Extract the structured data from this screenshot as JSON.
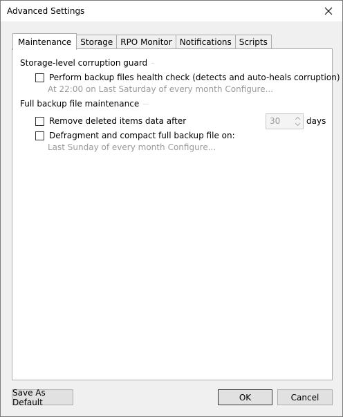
{
  "window": {
    "title": "Advanced Settings"
  },
  "tabs": [
    {
      "label": "Maintenance",
      "active": true
    },
    {
      "label": "Storage"
    },
    {
      "label": "RPO Monitor"
    },
    {
      "label": "Notifications"
    },
    {
      "label": "Scripts"
    }
  ],
  "guard": {
    "title": "Storage-level corruption guard",
    "health_check_label": "Perform backup files health check (detects and auto-heals corruption) on:",
    "schedule": "At 22:00 on Last Saturday of every month",
    "configure": "Configure..."
  },
  "maintenance": {
    "title": "Full backup file maintenance",
    "remove_label": "Remove deleted items data after",
    "remove_days": "30",
    "days_unit": "days",
    "defrag_label": "Defragment and compact full backup file on:",
    "schedule": "Last Sunday of every month",
    "configure": "Configure..."
  },
  "buttons": {
    "save_default": "Save As Default",
    "ok": "OK",
    "cancel": "Cancel"
  }
}
